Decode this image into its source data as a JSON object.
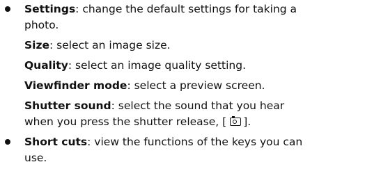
{
  "items": [
    {
      "term": "Settings",
      "desc_line1": ": change the default settings for taking a",
      "desc_line2": "photo.",
      "subitems": [
        {
          "term": "Size",
          "desc": ": select an image size."
        },
        {
          "term": "Quality",
          "desc": ": select an image quality setting."
        },
        {
          "term": "Viewfinder mode",
          "desc": ": select a preview screen."
        },
        {
          "term": "Shutter sound",
          "desc_line1": ": select the sound that you hear",
          "desc_line2_before": "when you press the shutter release, [",
          "desc_line2_after": "].",
          "icon": "camera-key-icon"
        }
      ]
    },
    {
      "term": "Short cuts",
      "desc_line1": ": view the functions of the keys you can",
      "desc_line2": "use."
    }
  ]
}
